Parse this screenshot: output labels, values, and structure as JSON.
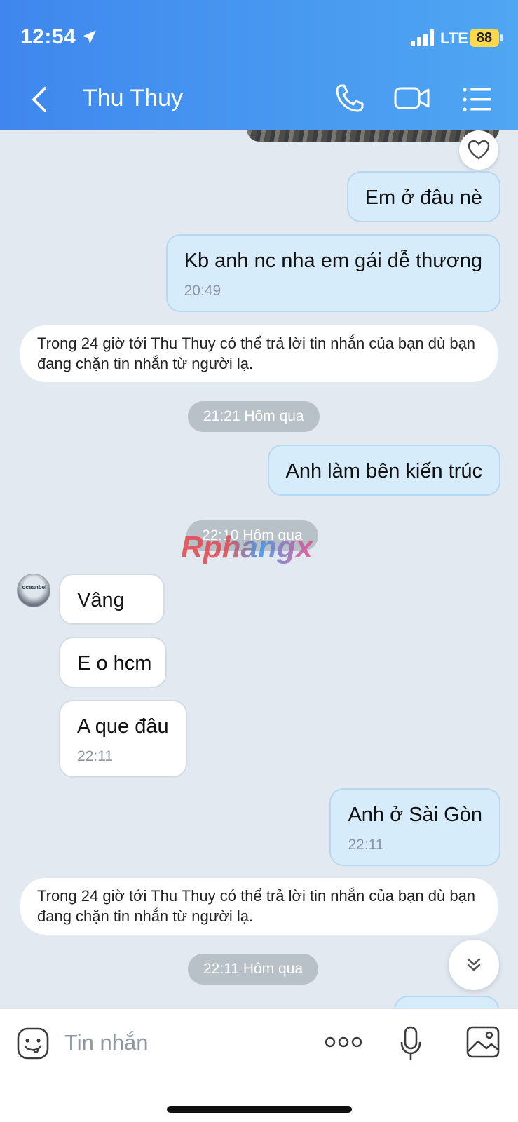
{
  "status_bar": {
    "time": "12:54",
    "network": "LTE",
    "battery": "88"
  },
  "header": {
    "title": "Thu Thuy"
  },
  "messages": {
    "m1": {
      "text": "Em ở đâu nè"
    },
    "m2": {
      "text": "Kb anh nc nha em gái dễ thương",
      "time": "20:49"
    },
    "notice1": "Trong 24 giờ tới Thu Thuy có thể trả lời tin nhắn của bạn dù bạn đang chặn tin nhắn từ người lạ.",
    "date1": "21:21 Hôm qua",
    "m3": {
      "text": "Anh làm bên kiến trúc"
    },
    "date2": "22:10 Hôm qua",
    "avatar_text": "oceanbel",
    "m4": {
      "text": "Vâng"
    },
    "m5": {
      "text": "E o hcm"
    },
    "m6": {
      "text": "A que đâu",
      "time": "22:11"
    },
    "m7": {
      "text": "Anh ở Sài Gòn",
      "time": "22:11"
    },
    "notice2": "Trong 24 giờ tới Thu Thuy có thể trả lời tin nhắn của bạn dù bạn đang chặn tin nhắn từ người lạ.",
    "date3": "22:11 Hôm qua"
  },
  "watermark": "Rphangx",
  "input": {
    "placeholder": "Tin nhắn",
    "value": ""
  },
  "icons": {
    "back": "chevron-left-icon",
    "phone": "phone-icon",
    "video": "video-camera-icon",
    "menu": "list-icon",
    "heart": "heart-icon",
    "scroll": "double-chevron-down-icon",
    "emoji": "emoji-icon",
    "more": "more-dots-icon",
    "mic": "microphone-icon",
    "image": "image-icon"
  },
  "colors": {
    "header_start": "#3f87ee",
    "header_end": "#4fa6f2",
    "chat_bg": "#e2e9f1",
    "out_bubble": "#d6ecfb",
    "battery": "#ffd84a"
  }
}
